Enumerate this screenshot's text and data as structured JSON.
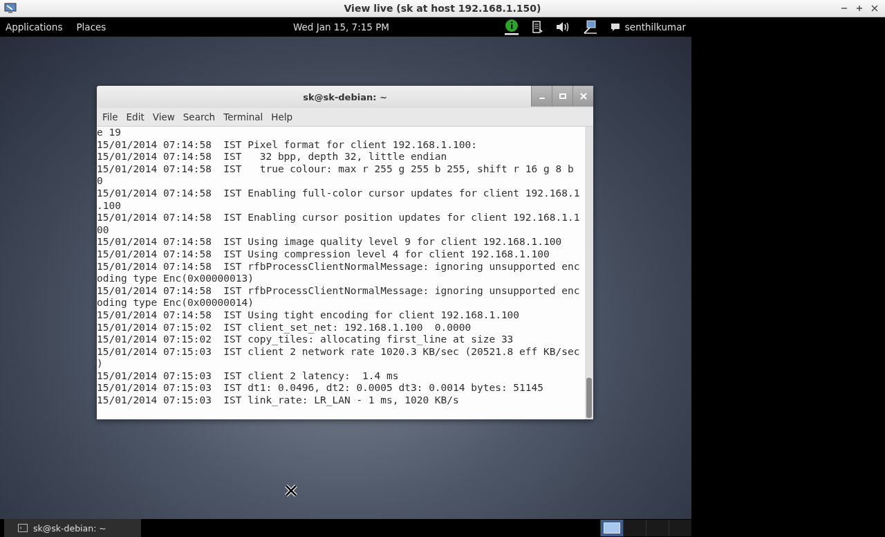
{
  "window": {
    "title": "View live (sk at host 192.168.1.150)"
  },
  "top_panel": {
    "menus": [
      "Applications",
      "Places"
    ],
    "clock": "Wed Jan 15,  7:15 PM",
    "user": "senthilkumar"
  },
  "terminal": {
    "title": "sk@sk-debian: ~",
    "menu": [
      "File",
      "Edit",
      "View",
      "Search",
      "Terminal",
      "Help"
    ],
    "lines": [
      "e 19",
      "15/01/2014 07:14:58  IST Pixel format for client 192.168.1.100:",
      "15/01/2014 07:14:58  IST   32 bpp, depth 32, little endian",
      "15/01/2014 07:14:58  IST   true colour: max r 255 g 255 b 255, shift r 16 g 8 b",
      "0",
      "15/01/2014 07:14:58  IST Enabling full-color cursor updates for client 192.168.1",
      ".100",
      "15/01/2014 07:14:58  IST Enabling cursor position updates for client 192.168.1.1",
      "00",
      "15/01/2014 07:14:58  IST Using image quality level 9 for client 192.168.1.100",
      "15/01/2014 07:14:58  IST Using compression level 4 for client 192.168.1.100",
      "15/01/2014 07:14:58  IST rfbProcessClientNormalMessage: ignoring unsupported enc",
      "oding type Enc(0x00000013)",
      "15/01/2014 07:14:58  IST rfbProcessClientNormalMessage: ignoring unsupported enc",
      "oding type Enc(0x00000014)",
      "15/01/2014 07:14:58  IST Using tight encoding for client 192.168.1.100",
      "15/01/2014 07:15:02  IST client_set_net: 192.168.1.100  0.0000",
      "15/01/2014 07:15:02  IST copy_tiles: allocating first_line at size 33",
      "15/01/2014 07:15:03  IST client 2 network rate 1020.3 KB/sec (20521.8 eff KB/sec",
      ")",
      "15/01/2014 07:15:03  IST client 2 latency:  1.4 ms",
      "15/01/2014 07:15:03  IST dt1: 0.0496, dt2: 0.0005 dt3: 0.0014 bytes: 51145",
      "15/01/2014 07:15:03  IST link_rate: LR_LAN - 1 ms, 1020 KB/s"
    ]
  },
  "taskbar": {
    "task": "sk@sk-debian: ~",
    "workspaces": [
      {
        "selected": true
      },
      {
        "selected": false
      },
      {
        "selected": false
      },
      {
        "selected": false
      }
    ]
  }
}
